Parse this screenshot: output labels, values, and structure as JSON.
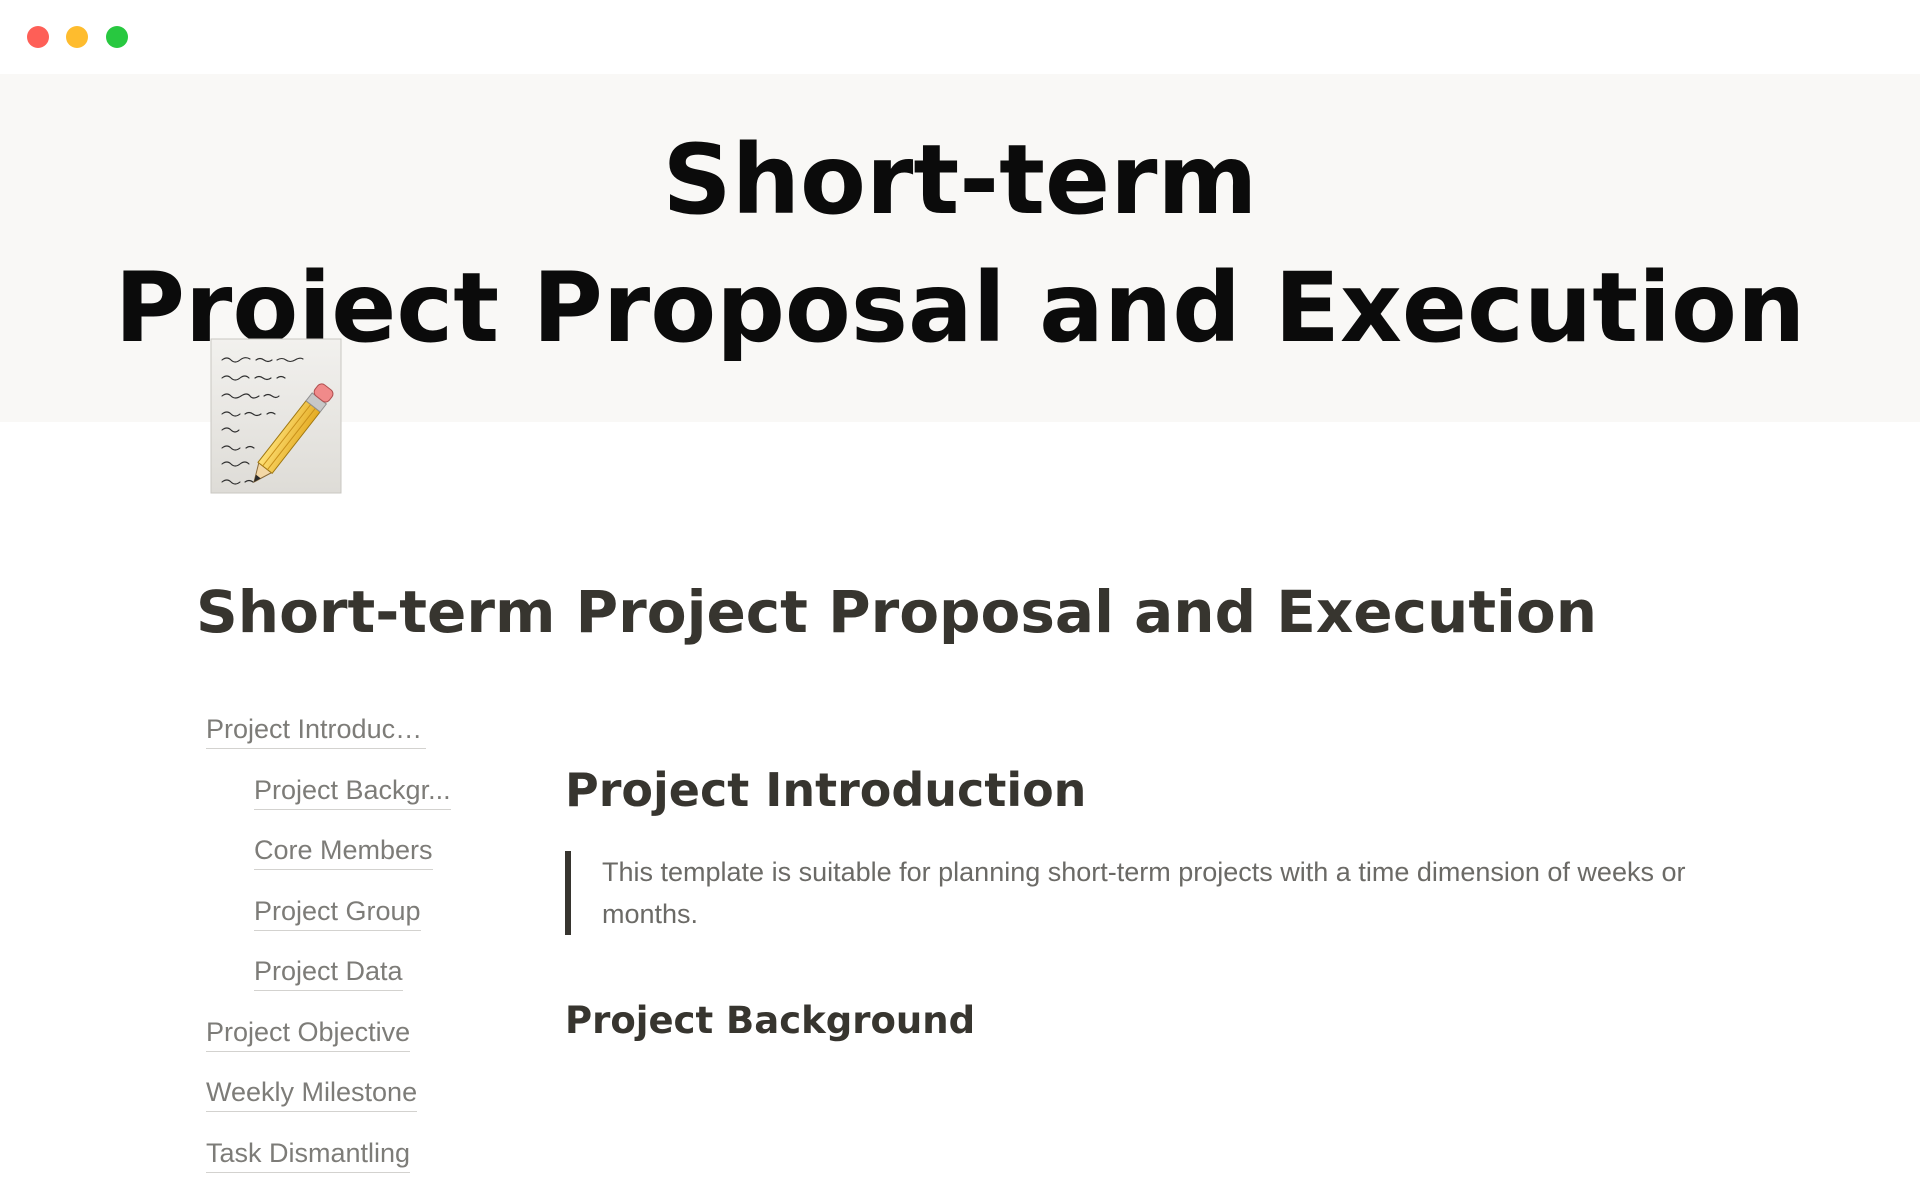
{
  "window": {
    "controls": [
      "close",
      "minimize",
      "zoom"
    ],
    "control_colors": {
      "close": "#fe5f57",
      "minimize": "#febc2e",
      "zoom": "#28c840"
    }
  },
  "cover": {
    "line1": "Short-term",
    "line2": "Project Proposal and Execution",
    "background": "#f9f8f6"
  },
  "page": {
    "icon": "memo-pencil-icon",
    "title": "Short-term Project Proposal and Execution"
  },
  "toc": {
    "items": [
      {
        "label": "Project Introduction",
        "level": 1
      },
      {
        "label": "Project Backgr...",
        "level": 2
      },
      {
        "label": "Core Members",
        "level": 2
      },
      {
        "label": "Project Group",
        "level": 2
      },
      {
        "label": "Project Data",
        "level": 2
      },
      {
        "label": "Project Objective",
        "level": 1
      },
      {
        "label": "Weekly Milestone",
        "level": 1
      },
      {
        "label": "Task Dismantling",
        "level": 1
      }
    ]
  },
  "content": {
    "heading1": "Project Introduction",
    "quote": "This template is suitable for planning short-term projects with a time dimension of weeks or months.",
    "heading2": "Project Background"
  }
}
